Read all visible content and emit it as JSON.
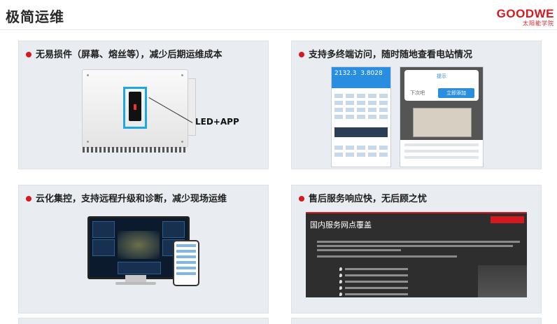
{
  "page": {
    "title": "极简运维",
    "logo_text": "GOODWE",
    "logo_subtext": "太阳能学院"
  },
  "panels": [
    {
      "heading": "无易损件（屏幕、熔丝等），减少后期运维成本",
      "label": "LED+APP"
    },
    {
      "heading": "支持多终端访问，随时随地查看电站情况",
      "phone1_values": [
        "2132.3",
        "3.8028"
      ],
      "dialog_title": "提示",
      "dialog_cancel": "下次吧",
      "dialog_confirm": "立即添加"
    },
    {
      "heading": "云化集控，支持远程升级和诊断，减少现场运维"
    },
    {
      "heading": "售后服务响应快，无后顾之忧",
      "slide_title": "国内服务网点覆盖"
    }
  ],
  "colors": {
    "accent": "#d7191f",
    "panel_bg": "#e9edf1",
    "highlight": "#1ea7e0"
  }
}
